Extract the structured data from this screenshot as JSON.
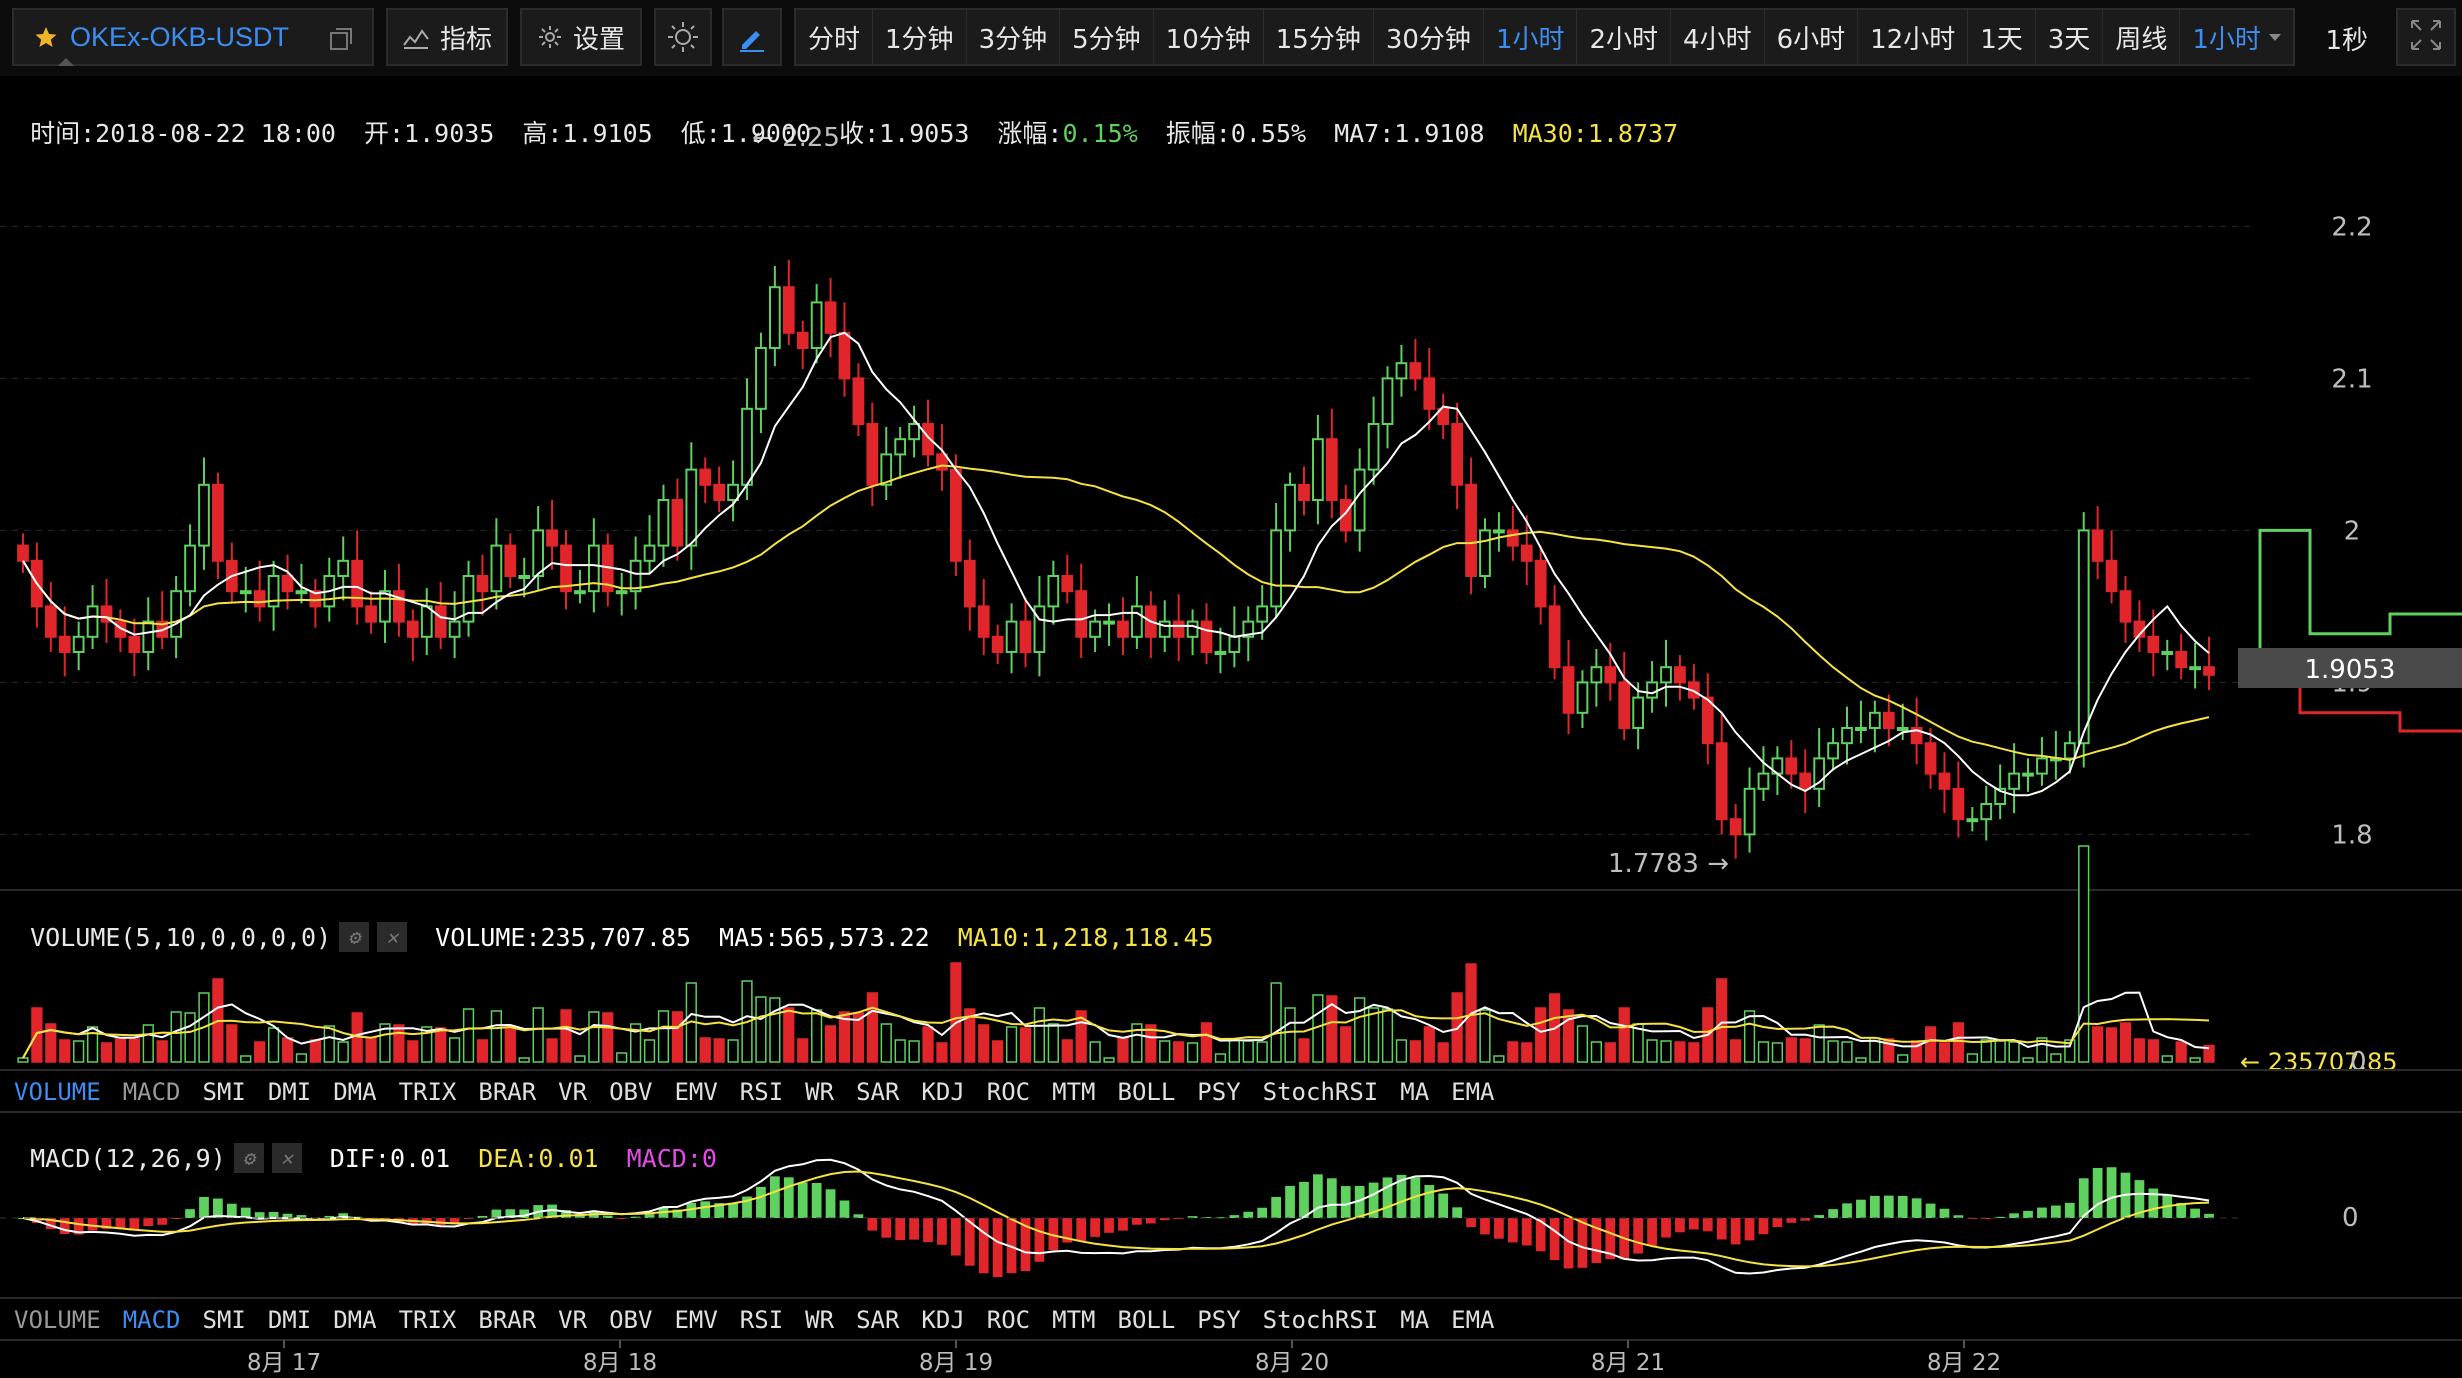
{
  "toolbar": {
    "symbol": "OKEx-OKB-USDT",
    "indicators_label": "指标",
    "settings_label": "设置",
    "periods": [
      "分时",
      "1分钟",
      "3分钟",
      "5分钟",
      "10分钟",
      "15分钟",
      "30分钟",
      "1小时",
      "2小时",
      "4小时",
      "6小时",
      "12小时",
      "1天",
      "3天",
      "周线"
    ],
    "active_period": "1小时",
    "period_dropdown": "1小时",
    "refresh_interval": "1秒"
  },
  "ohlc": {
    "time": "时间:2018-08-22 18:00",
    "open": "开:1.9035",
    "high": "高:1.9105",
    "low": "低:1.9000",
    "close": "收:1.9053",
    "change_label": "涨幅:",
    "change_value": "0.15%",
    "amplitude": "振幅:0.55%",
    "ma7": "MA7:1.9108",
    "ma30": "MA30:1.8737"
  },
  "volume_panel": {
    "title": "VOLUME(5,10,0,0,0,0)",
    "volume": "VOLUME:235,707.85",
    "ma5": "MA5:565,573.22",
    "ma10": "MA10:1,218,118.45",
    "current_marker": "235707.85",
    "axis_zero": "0"
  },
  "macd_panel": {
    "title": "MACD(12,26,9)",
    "dif": "DIF:0.01",
    "dea": "DEA:0.01",
    "macd": "MACD:0",
    "axis_zero": "0"
  },
  "tabs_1": {
    "items": [
      "VOLUME",
      "MACD",
      "SMI",
      "DMI",
      "DMA",
      "TRIX",
      "BRAR",
      "VR",
      "OBV",
      "EMV",
      "RSI",
      "WR",
      "SAR",
      "KDJ",
      "ROC",
      "MTM",
      "BOLL",
      "PSY",
      "StochRSI",
      "MA",
      "EMA"
    ],
    "active": "VOLUME",
    "dim": [
      "MACD"
    ]
  },
  "tabs_2": {
    "items": [
      "VOLUME",
      "MACD",
      "SMI",
      "DMI",
      "DMA",
      "TRIX",
      "BRAR",
      "VR",
      "OBV",
      "EMV",
      "RSI",
      "WR",
      "SAR",
      "KDJ",
      "ROC",
      "MTM",
      "BOLL",
      "PSY",
      "StochRSI",
      "MA",
      "EMA"
    ],
    "active": "MACD",
    "dim": [
      "VOLUME"
    ]
  },
  "price_axis": {
    "ticks": [
      2.2,
      2.1,
      2,
      1.9,
      1.8
    ],
    "current_price": "1.9053"
  },
  "annotations": {
    "high_label": "2.25",
    "low_label": "1.7783"
  },
  "date_axis": [
    "8月 17",
    "8月 18",
    "8月 19",
    "8月 20",
    "8月 21",
    "8月 22"
  ],
  "colors": {
    "up": "#5ed15e",
    "down": "#e0262a",
    "accent": "#3d8ef2",
    "ma30": "#f6e243",
    "ma7": "#ffffff",
    "macd": "#e44ae4"
  },
  "chart_data": {
    "type": "candlestick",
    "timeframe": "1小时",
    "close_series": [
      1.98,
      1.95,
      1.93,
      1.92,
      1.93,
      1.95,
      1.94,
      1.93,
      1.92,
      1.94,
      1.93,
      1.96,
      1.99,
      2.03,
      1.98,
      1.96,
      1.96,
      1.95,
      1.97,
      1.96,
      1.96,
      1.95,
      1.97,
      1.98,
      1.95,
      1.94,
      1.96,
      1.94,
      1.93,
      1.95,
      1.93,
      1.94,
      1.97,
      1.96,
      1.99,
      1.97,
      1.97,
      2.0,
      1.99,
      1.96,
      1.96,
      1.99,
      1.96,
      1.96,
      1.98,
      1.99,
      2.02,
      1.99,
      2.04,
      2.03,
      2.02,
      2.03,
      2.08,
      2.12,
      2.16,
      2.13,
      2.12,
      2.15,
      2.13,
      2.1,
      2.07,
      2.03,
      2.05,
      2.06,
      2.07,
      2.05,
      2.04,
      1.98,
      1.95,
      1.93,
      1.92,
      1.94,
      1.92,
      1.95,
      1.97,
      1.96,
      1.93,
      1.94,
      1.94,
      1.93,
      1.95,
      1.93,
      1.94,
      1.93,
      1.94,
      1.92,
      1.92,
      1.93,
      1.94,
      1.95,
      2.0,
      2.03,
      2.02,
      2.06,
      2.02,
      2.0,
      2.04,
      2.07,
      2.1,
      2.11,
      2.1,
      2.08,
      2.07,
      2.03,
      1.97,
      2.0,
      2.0,
      1.99,
      1.98,
      1.95,
      1.91,
      1.88,
      1.9,
      1.91,
      1.9,
      1.87,
      1.89,
      1.9,
      1.91,
      1.9,
      1.89,
      1.86,
      1.81,
      1.8,
      1.83,
      1.84,
      1.85,
      1.84,
      1.83,
      1.85,
      1.86,
      1.87,
      1.87,
      1.88,
      1.87,
      1.87,
      1.86,
      1.84,
      1.83,
      1.81,
      1.81,
      1.82,
      1.83,
      1.84,
      1.84,
      1.85,
      1.85,
      1.86,
      2.0,
      1.98,
      1.96,
      1.94,
      1.93,
      1.92,
      1.92,
      1.91,
      1.91,
      1.905
    ],
    "ma7_last": 1.9108,
    "ma30_last": 1.8737,
    "y_range": [
      1.77,
      2.27
    ],
    "price_ticks": [
      1.8,
      1.9,
      2.0,
      2.1,
      2.2
    ],
    "x_labels": [
      "8月 17",
      "8月 18",
      "8月 19",
      "8月 20",
      "8月 21",
      "8月 22"
    ]
  }
}
